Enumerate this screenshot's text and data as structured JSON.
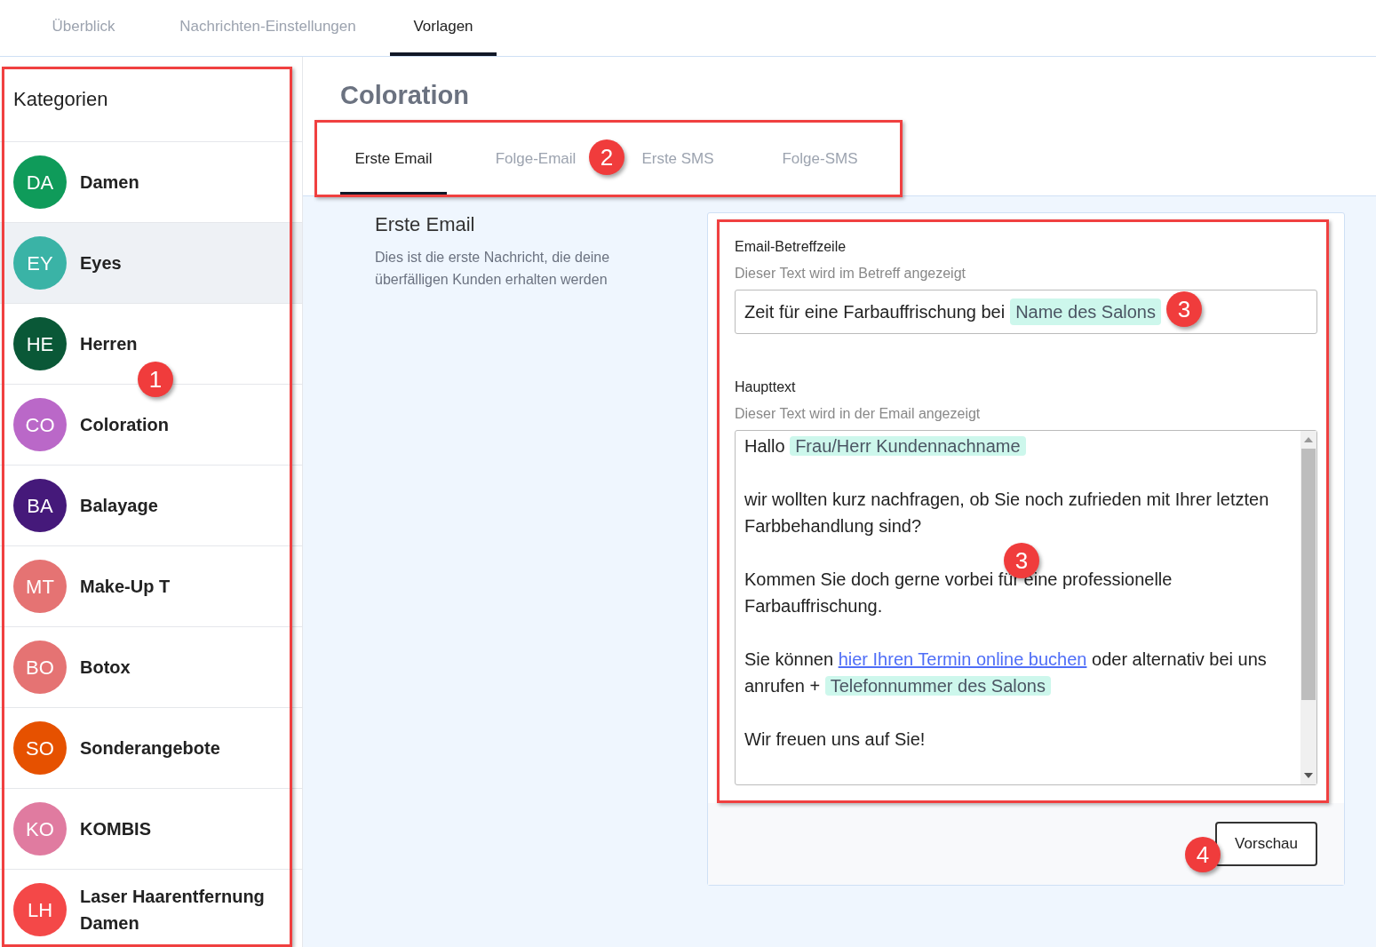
{
  "top_tabs": [
    {
      "label": "Überblick",
      "selected": false
    },
    {
      "label": "Nachrichten-Einstellungen",
      "selected": false
    },
    {
      "label": "Vorlagen",
      "selected": true
    }
  ],
  "sidebar": {
    "title": "Kategorien",
    "items": [
      {
        "initials": "DA",
        "name": "Damen",
        "color": "#0f9b5a",
        "hovered": false
      },
      {
        "initials": "EY",
        "name": "Eyes",
        "color": "#3ab3a6",
        "hovered": true
      },
      {
        "initials": "HE",
        "name": "Herren",
        "color": "#0a5837",
        "hovered": false
      },
      {
        "initials": "CO",
        "name": "Coloration",
        "color": "#ba68c8",
        "hovered": false
      },
      {
        "initials": "BA",
        "name": "Balayage",
        "color": "#45197a",
        "hovered": false
      },
      {
        "initials": "MT",
        "name": "Make-Up T",
        "color": "#e57373",
        "hovered": false
      },
      {
        "initials": "BO",
        "name": "Botox",
        "color": "#e57373",
        "hovered": false
      },
      {
        "initials": "SO",
        "name": "Sonderangebote",
        "color": "#e65100",
        "hovered": false
      },
      {
        "initials": "KO",
        "name": "KOMBIS",
        "color": "#e07ba0",
        "hovered": false
      },
      {
        "initials": "LH",
        "name": "Laser Haarentfernung Damen",
        "color": "#f44848",
        "hovered": false
      }
    ]
  },
  "page_title": "Coloration",
  "sub_tabs": [
    {
      "label": "Erste Email",
      "selected": true
    },
    {
      "label": "Folge-Email",
      "selected": false
    },
    {
      "label": "Erste SMS",
      "selected": false
    },
    {
      "label": "Folge-SMS",
      "selected": false
    }
  ],
  "section": {
    "title": "Erste Email",
    "description": "Dies ist die erste Nachricht, die deine überfälligen Kunden erhalten werden"
  },
  "subject": {
    "label": "Email-Betreffzeile",
    "hint": "Dieser Text wird im Betreff angezeigt",
    "value": [
      {
        "kind": "text",
        "text": "Zeit für eine Farbauffrischung bei"
      },
      {
        "kind": "token",
        "text": "Name des Salons"
      }
    ]
  },
  "body": {
    "label": "Haupttext",
    "hint": "Dieser Text wird in der Email angezeigt",
    "paragraphs": [
      [
        {
          "kind": "text",
          "text": "Hallo"
        },
        {
          "kind": "token",
          "text": "Frau/Herr Kundennachname"
        }
      ],
      [
        {
          "kind": "text",
          "text": "wir wollten kurz nachfragen, ob Sie noch zufrieden mit Ihrer letzten Farbbehandlung sind?"
        }
      ],
      [
        {
          "kind": "text",
          "text": "Kommen Sie doch gerne vorbei für eine professionelle Farbauffrischung."
        }
      ],
      [
        {
          "kind": "text",
          "text": "Sie können"
        },
        {
          "kind": "link",
          "text": "hier Ihren Termin online buchen"
        },
        {
          "kind": "text",
          "text": "oder alternativ bei uns anrufen +"
        },
        {
          "kind": "token",
          "text": "Telefonnummer des Salons"
        }
      ],
      [
        {
          "kind": "text",
          "text": "Wir freuen uns auf Sie!"
        }
      ]
    ]
  },
  "preview_button": "Vorschau",
  "annotations": [
    {
      "label": "1"
    },
    {
      "label": "2"
    },
    {
      "label": "3"
    },
    {
      "label": "3"
    },
    {
      "label": "4"
    }
  ]
}
